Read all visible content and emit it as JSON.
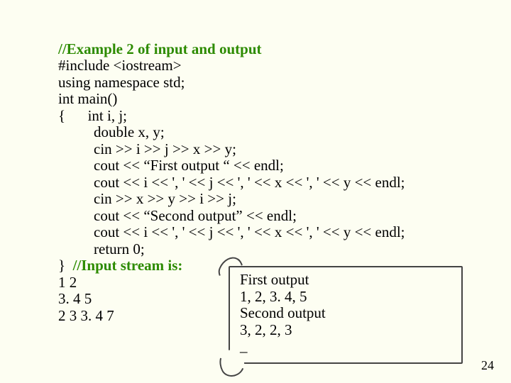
{
  "code": {
    "c1": "//Example 2 of input and output",
    "l2": "#include <iostream>",
    "l3": "using namespace std;",
    "l4": "int main()",
    "l5a": "{",
    "l5b": "int i, j;",
    "l6": "double x, y;",
    "l7": "cin >> i >> j >> x >> y;",
    "l8": "cout << “First output “ << endl;",
    "l9": "cout << i << ', ' << j << ', ' << x << ', ' << y << endl;",
    "l10": "cin >> x >> y >> i >> j;",
    "l11": "cout << “Second output” << endl;",
    "l12": "cout << i << ', ' << j << ', ' << x << ', ' << y << endl;",
    "l13": "return 0;",
    "l14a": "}",
    "c14b": "//Input stream is:",
    "l15": "1 2",
    "l16": "3. 4 5",
    "l17": "2 3 3. 4 7"
  },
  "output": {
    "o1": "First output",
    "o2": "1, 2, 3. 4, 5",
    "o3": "Second output",
    "o4": "3, 2, 2, 3",
    "o5": "_"
  },
  "page_number": "24"
}
